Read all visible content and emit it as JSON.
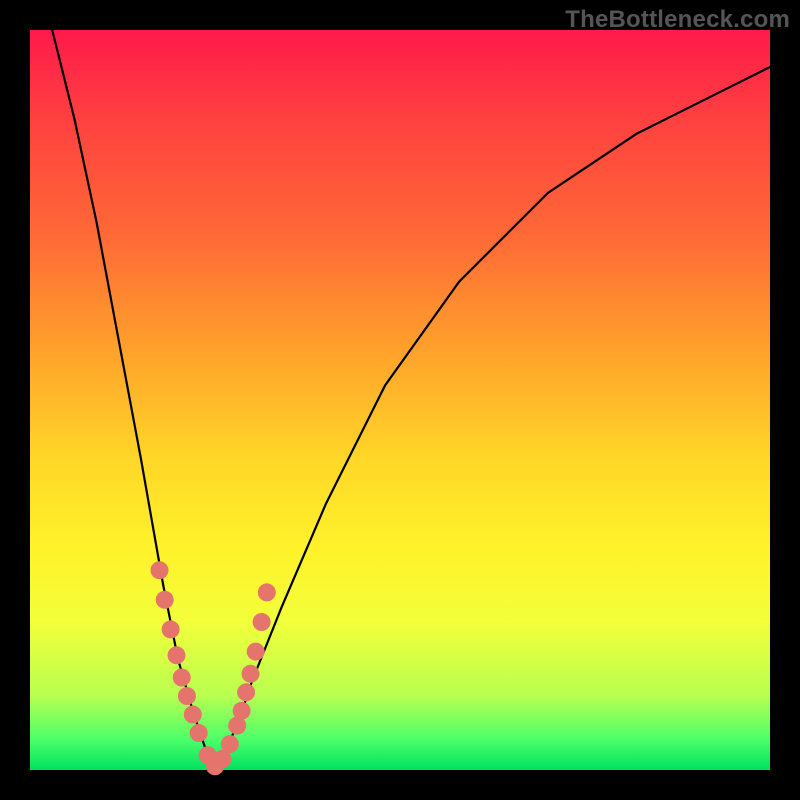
{
  "watermark": "TheBottleneck.com",
  "colors": {
    "frame": "#000000",
    "curve": "#000000",
    "marker": "#e5746c",
    "gradient_stops": [
      "#ff1a4a",
      "#ff4040",
      "#ff6a36",
      "#ffa42a",
      "#ffd728",
      "#fff22a",
      "#f2ff3a",
      "#b8ff50",
      "#4aff6a",
      "#00e060"
    ]
  },
  "chart_data": {
    "type": "line",
    "title": "",
    "xlabel": "",
    "ylabel": "",
    "xlim": [
      0,
      100
    ],
    "ylim": [
      0,
      100
    ],
    "note": "Bottleneck-style V curve; minimum near x≈25, rising steep on left side and asymptotically on right. Values estimated from pixel positions; image has no numeric axes.",
    "series": [
      {
        "name": "bottleneck-curve",
        "x": [
          3,
          6,
          9,
          12,
          15,
          18,
          20,
          22,
          24,
          25,
          26,
          28,
          30,
          34,
          40,
          48,
          58,
          70,
          82,
          94,
          100
        ],
        "y": [
          100,
          88,
          74,
          58,
          42,
          25,
          15,
          8,
          2,
          0,
          2,
          6,
          12,
          22,
          36,
          52,
          66,
          78,
          86,
          92,
          95
        ]
      }
    ],
    "markers": {
      "name": "highlighted-points",
      "x": [
        17.5,
        18.2,
        19.0,
        19.8,
        20.5,
        21.2,
        22.0,
        22.8,
        24.0,
        25.0,
        26.0,
        27.0,
        28.0,
        28.6,
        29.2,
        29.8,
        30.5,
        31.3,
        32.0
      ],
      "y": [
        27,
        23,
        19,
        15.5,
        12.5,
        10,
        7.5,
        5,
        2,
        0.5,
        1.5,
        3.5,
        6,
        8,
        10.5,
        13,
        16,
        20,
        24
      ]
    }
  }
}
